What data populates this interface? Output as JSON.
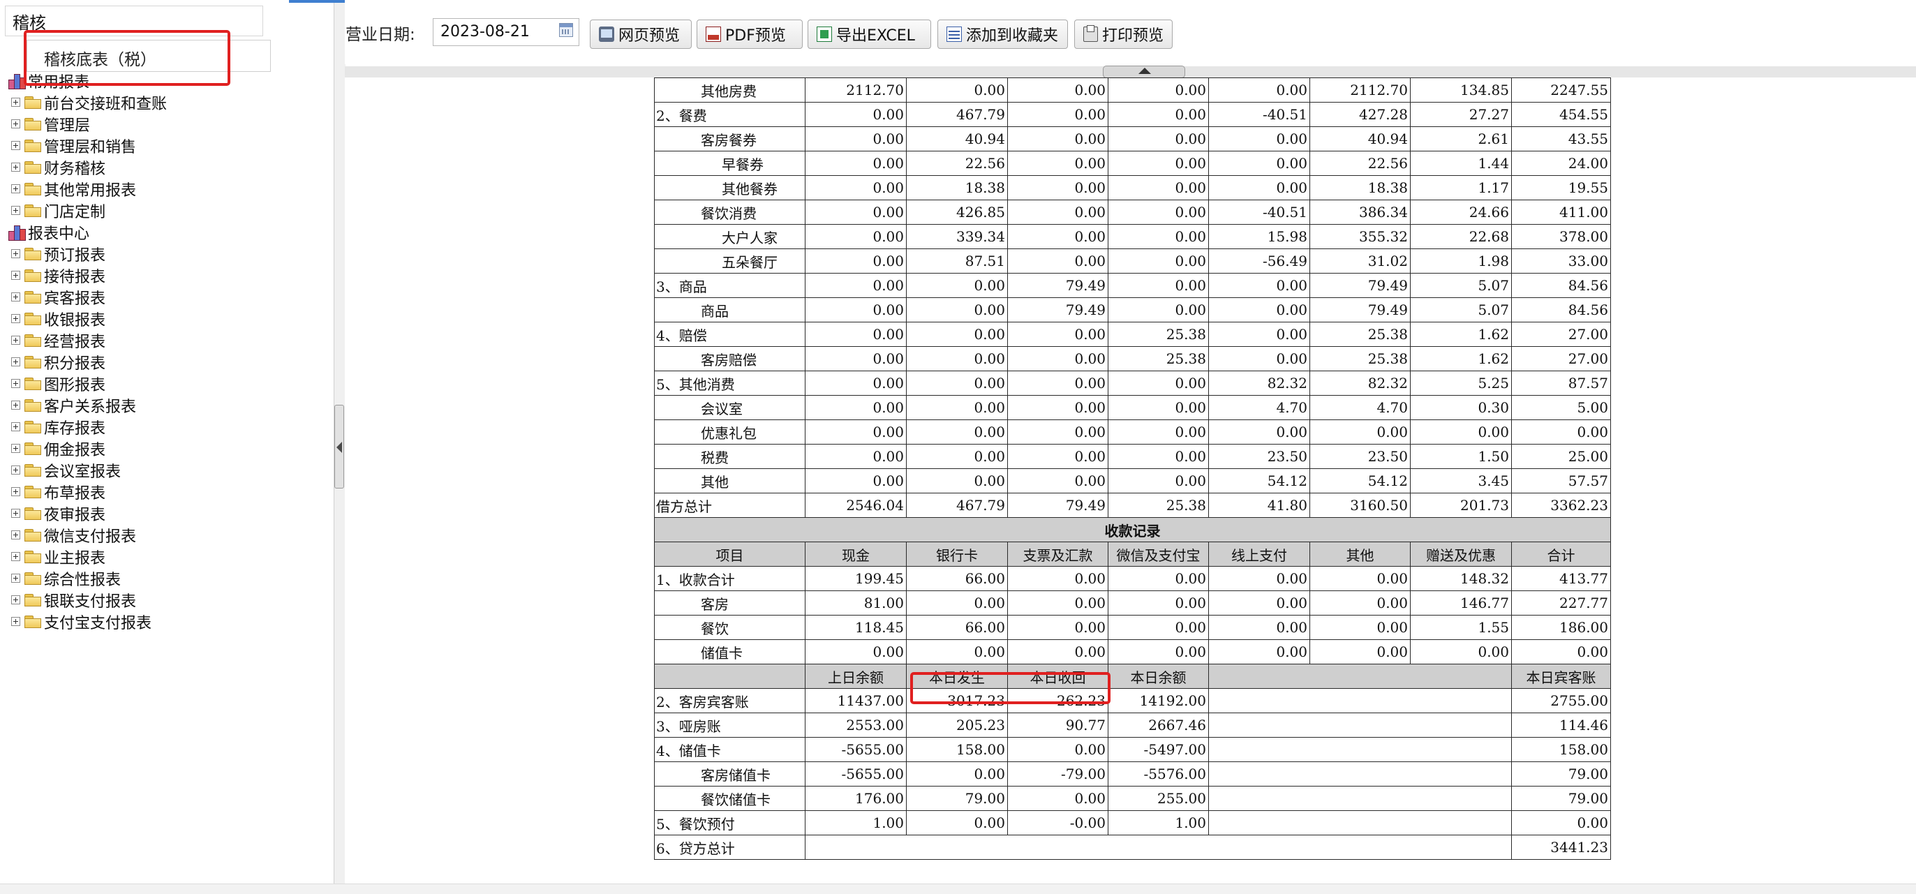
{
  "sidebar": {
    "search_value": "稽核",
    "suggestion": "稽核底表（税）",
    "tree": [
      {
        "kind": "root",
        "label": "常用报表"
      },
      {
        "kind": "folder",
        "label": "前台交接班和查账"
      },
      {
        "kind": "folder",
        "label": "管理层"
      },
      {
        "kind": "folder",
        "label": "管理层和销售"
      },
      {
        "kind": "folder",
        "label": "财务稽核"
      },
      {
        "kind": "folder",
        "label": "其他常用报表"
      },
      {
        "kind": "folder",
        "label": "门店定制"
      },
      {
        "kind": "root",
        "label": "报表中心"
      },
      {
        "kind": "folder",
        "label": "预订报表"
      },
      {
        "kind": "folder",
        "label": "接待报表"
      },
      {
        "kind": "folder",
        "label": "宾客报表"
      },
      {
        "kind": "folder",
        "label": "收银报表"
      },
      {
        "kind": "folder",
        "label": "经营报表"
      },
      {
        "kind": "folder",
        "label": "积分报表"
      },
      {
        "kind": "folder",
        "label": "图形报表"
      },
      {
        "kind": "folder",
        "label": "客户关系报表"
      },
      {
        "kind": "folder",
        "label": "库存报表"
      },
      {
        "kind": "folder",
        "label": "佣金报表"
      },
      {
        "kind": "folder",
        "label": "会议室报表"
      },
      {
        "kind": "folder",
        "label": "布草报表"
      },
      {
        "kind": "folder",
        "label": "夜审报表"
      },
      {
        "kind": "folder",
        "label": "微信支付报表"
      },
      {
        "kind": "folder",
        "label": "业主报表"
      },
      {
        "kind": "folder",
        "label": "综合性报表"
      },
      {
        "kind": "folder",
        "label": "银联支付报表"
      },
      {
        "kind": "folder",
        "label": "支付宝支付报表"
      }
    ]
  },
  "toolbar": {
    "date_label": "营业日期:",
    "date_value": "2023-08-21",
    "buttons": {
      "web_preview": "网页预览",
      "pdf_preview": "PDF预览",
      "export_excel": "导出EXCEL",
      "add_favorite": "添加到收藏夹",
      "print_preview": "打印预览"
    }
  },
  "report": {
    "debit_rows": [
      {
        "item": "其他房费",
        "indent": 2,
        "v": [
          "2112.70",
          "0.00",
          "0.00",
          "0.00",
          "0.00",
          "2112.70",
          "134.85",
          "2247.55"
        ]
      },
      {
        "item": "2、餐费",
        "indent": 0,
        "v": [
          "0.00",
          "467.79",
          "0.00",
          "0.00",
          "-40.51",
          "427.28",
          "27.27",
          "454.55"
        ]
      },
      {
        "item": "客房餐券",
        "indent": 2,
        "v": [
          "0.00",
          "40.94",
          "0.00",
          "0.00",
          "0.00",
          "40.94",
          "2.61",
          "43.55"
        ]
      },
      {
        "item": "早餐券",
        "indent": 3,
        "v": [
          "0.00",
          "22.56",
          "0.00",
          "0.00",
          "0.00",
          "22.56",
          "1.44",
          "24.00"
        ]
      },
      {
        "item": "其他餐券",
        "indent": 3,
        "v": [
          "0.00",
          "18.38",
          "0.00",
          "0.00",
          "0.00",
          "18.38",
          "1.17",
          "19.55"
        ]
      },
      {
        "item": "餐饮消费",
        "indent": 2,
        "v": [
          "0.00",
          "426.85",
          "0.00",
          "0.00",
          "-40.51",
          "386.34",
          "24.66",
          "411.00"
        ]
      },
      {
        "item": "大户人家",
        "indent": 3,
        "v": [
          "0.00",
          "339.34",
          "0.00",
          "0.00",
          "15.98",
          "355.32",
          "22.68",
          "378.00"
        ]
      },
      {
        "item": "五朵餐厅",
        "indent": 3,
        "v": [
          "0.00",
          "87.51",
          "0.00",
          "0.00",
          "-56.49",
          "31.02",
          "1.98",
          "33.00"
        ]
      },
      {
        "item": "3、商品",
        "indent": 0,
        "v": [
          "0.00",
          "0.00",
          "79.49",
          "0.00",
          "0.00",
          "79.49",
          "5.07",
          "84.56"
        ]
      },
      {
        "item": "商品",
        "indent": 2,
        "v": [
          "0.00",
          "0.00",
          "79.49",
          "0.00",
          "0.00",
          "79.49",
          "5.07",
          "84.56"
        ]
      },
      {
        "item": "4、赔偿",
        "indent": 0,
        "v": [
          "0.00",
          "0.00",
          "0.00",
          "25.38",
          "0.00",
          "25.38",
          "1.62",
          "27.00"
        ]
      },
      {
        "item": "客房赔偿",
        "indent": 2,
        "v": [
          "0.00",
          "0.00",
          "0.00",
          "25.38",
          "0.00",
          "25.38",
          "1.62",
          "27.00"
        ]
      },
      {
        "item": "5、其他消费",
        "indent": 0,
        "v": [
          "0.00",
          "0.00",
          "0.00",
          "0.00",
          "82.32",
          "82.32",
          "5.25",
          "87.57"
        ]
      },
      {
        "item": "会议室",
        "indent": 2,
        "v": [
          "0.00",
          "0.00",
          "0.00",
          "0.00",
          "4.70",
          "4.70",
          "0.30",
          "5.00"
        ]
      },
      {
        "item": "优惠礼包",
        "indent": 2,
        "v": [
          "0.00",
          "0.00",
          "0.00",
          "0.00",
          "0.00",
          "0.00",
          "0.00",
          "0.00"
        ]
      },
      {
        "item": "税费",
        "indent": 2,
        "v": [
          "0.00",
          "0.00",
          "0.00",
          "0.00",
          "23.50",
          "23.50",
          "1.50",
          "25.00"
        ]
      },
      {
        "item": "其他",
        "indent": 2,
        "v": [
          "0.00",
          "0.00",
          "0.00",
          "0.00",
          "54.12",
          "54.12",
          "3.45",
          "57.57"
        ]
      },
      {
        "item": "借方总计",
        "indent": 0,
        "v": [
          "2546.04",
          "467.79",
          "79.49",
          "25.38",
          "41.80",
          "3160.50",
          "201.73",
          "3362.23"
        ]
      }
    ],
    "receipts_title": "收款记录",
    "receipts_headers": [
      "项目",
      "现金",
      "银行卡",
      "支票及汇款",
      "微信及支付宝",
      "线上支付",
      "其他",
      "赠送及优惠",
      "合计"
    ],
    "receipt_rows": [
      {
        "item": "1、收款合计",
        "indent": 0,
        "v": [
          "199.45",
          "66.00",
          "0.00",
          "0.00",
          "0.00",
          "0.00",
          "148.32",
          "413.77"
        ]
      },
      {
        "item": "客房",
        "indent": 2,
        "v": [
          "81.00",
          "0.00",
          "0.00",
          "0.00",
          "0.00",
          "0.00",
          "146.77",
          "227.77"
        ]
      },
      {
        "item": "餐饮",
        "indent": 2,
        "v": [
          "118.45",
          "66.00",
          "0.00",
          "0.00",
          "0.00",
          "0.00",
          "1.55",
          "186.00"
        ]
      },
      {
        "item": "储值卡",
        "indent": 2,
        "v": [
          "0.00",
          "0.00",
          "0.00",
          "0.00",
          "0.00",
          "0.00",
          "0.00",
          "0.00"
        ]
      }
    ],
    "balance_headers": [
      "上日余额",
      "本日发生",
      "本日收回",
      "本日余额",
      "本日宾客账"
    ],
    "balance_rows": [
      {
        "item": "2、客房宾客账",
        "indent": 0,
        "v": [
          "11437.00",
          "3017.23",
          "262.23",
          "14192.00"
        ],
        "guest": "2755.00"
      },
      {
        "item": "3、哑房账",
        "indent": 0,
        "v": [
          "2553.00",
          "205.23",
          "90.77",
          "2667.46"
        ],
        "guest": "114.46"
      },
      {
        "item": "4、储值卡",
        "indent": 0,
        "v": [
          "-5655.00",
          "158.00",
          "0.00",
          "-5497.00"
        ],
        "guest": "158.00"
      },
      {
        "item": "客房储值卡",
        "indent": 2,
        "v": [
          "-5655.00",
          "0.00",
          "-79.00",
          "-5576.00"
        ],
        "guest": "79.00"
      },
      {
        "item": "餐饮储值卡",
        "indent": 2,
        "v": [
          "176.00",
          "79.00",
          "0.00",
          "255.00"
        ],
        "guest": "79.00"
      },
      {
        "item": "5、餐饮预付",
        "indent": 0,
        "v": [
          "1.00",
          "0.00",
          "-0.00",
          "1.00"
        ],
        "guest": "0.00"
      }
    ],
    "credit_total": {
      "item": "6、贷方总计",
      "value": "3441.23"
    }
  },
  "colors": {
    "highlight_red": "#e02020",
    "header_gray": "#cfcfcf",
    "accent_blue": "#3f7fd0"
  }
}
